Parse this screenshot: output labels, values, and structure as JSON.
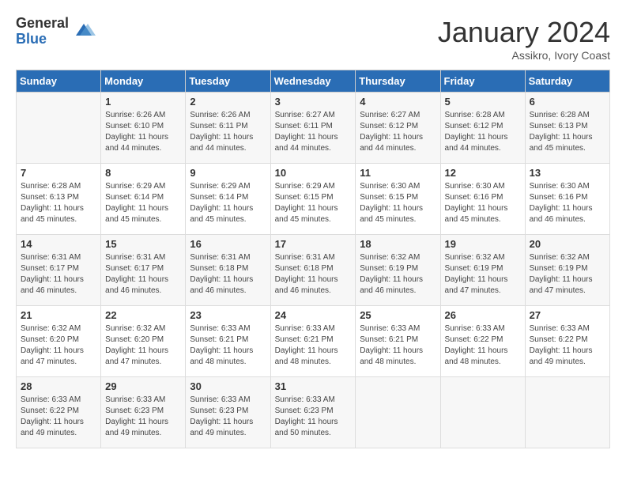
{
  "header": {
    "logo_general": "General",
    "logo_blue": "Blue",
    "month_title": "January 2024",
    "subtitle": "Assikro, Ivory Coast"
  },
  "calendar": {
    "days_of_week": [
      "Sunday",
      "Monday",
      "Tuesday",
      "Wednesday",
      "Thursday",
      "Friday",
      "Saturday"
    ],
    "weeks": [
      [
        {
          "day": "",
          "sunrise": "",
          "sunset": "",
          "daylight": ""
        },
        {
          "day": "1",
          "sunrise": "Sunrise: 6:26 AM",
          "sunset": "Sunset: 6:10 PM",
          "daylight": "Daylight: 11 hours and 44 minutes."
        },
        {
          "day": "2",
          "sunrise": "Sunrise: 6:26 AM",
          "sunset": "Sunset: 6:11 PM",
          "daylight": "Daylight: 11 hours and 44 minutes."
        },
        {
          "day": "3",
          "sunrise": "Sunrise: 6:27 AM",
          "sunset": "Sunset: 6:11 PM",
          "daylight": "Daylight: 11 hours and 44 minutes."
        },
        {
          "day": "4",
          "sunrise": "Sunrise: 6:27 AM",
          "sunset": "Sunset: 6:12 PM",
          "daylight": "Daylight: 11 hours and 44 minutes."
        },
        {
          "day": "5",
          "sunrise": "Sunrise: 6:28 AM",
          "sunset": "Sunset: 6:12 PM",
          "daylight": "Daylight: 11 hours and 44 minutes."
        },
        {
          "day": "6",
          "sunrise": "Sunrise: 6:28 AM",
          "sunset": "Sunset: 6:13 PM",
          "daylight": "Daylight: 11 hours and 45 minutes."
        }
      ],
      [
        {
          "day": "7",
          "sunrise": "Sunrise: 6:28 AM",
          "sunset": "Sunset: 6:13 PM",
          "daylight": "Daylight: 11 hours and 45 minutes."
        },
        {
          "day": "8",
          "sunrise": "Sunrise: 6:29 AM",
          "sunset": "Sunset: 6:14 PM",
          "daylight": "Daylight: 11 hours and 45 minutes."
        },
        {
          "day": "9",
          "sunrise": "Sunrise: 6:29 AM",
          "sunset": "Sunset: 6:14 PM",
          "daylight": "Daylight: 11 hours and 45 minutes."
        },
        {
          "day": "10",
          "sunrise": "Sunrise: 6:29 AM",
          "sunset": "Sunset: 6:15 PM",
          "daylight": "Daylight: 11 hours and 45 minutes."
        },
        {
          "day": "11",
          "sunrise": "Sunrise: 6:30 AM",
          "sunset": "Sunset: 6:15 PM",
          "daylight": "Daylight: 11 hours and 45 minutes."
        },
        {
          "day": "12",
          "sunrise": "Sunrise: 6:30 AM",
          "sunset": "Sunset: 6:16 PM",
          "daylight": "Daylight: 11 hours and 45 minutes."
        },
        {
          "day": "13",
          "sunrise": "Sunrise: 6:30 AM",
          "sunset": "Sunset: 6:16 PM",
          "daylight": "Daylight: 11 hours and 46 minutes."
        }
      ],
      [
        {
          "day": "14",
          "sunrise": "Sunrise: 6:31 AM",
          "sunset": "Sunset: 6:17 PM",
          "daylight": "Daylight: 11 hours and 46 minutes."
        },
        {
          "day": "15",
          "sunrise": "Sunrise: 6:31 AM",
          "sunset": "Sunset: 6:17 PM",
          "daylight": "Daylight: 11 hours and 46 minutes."
        },
        {
          "day": "16",
          "sunrise": "Sunrise: 6:31 AM",
          "sunset": "Sunset: 6:18 PM",
          "daylight": "Daylight: 11 hours and 46 minutes."
        },
        {
          "day": "17",
          "sunrise": "Sunrise: 6:31 AM",
          "sunset": "Sunset: 6:18 PM",
          "daylight": "Daylight: 11 hours and 46 minutes."
        },
        {
          "day": "18",
          "sunrise": "Sunrise: 6:32 AM",
          "sunset": "Sunset: 6:19 PM",
          "daylight": "Daylight: 11 hours and 46 minutes."
        },
        {
          "day": "19",
          "sunrise": "Sunrise: 6:32 AM",
          "sunset": "Sunset: 6:19 PM",
          "daylight": "Daylight: 11 hours and 47 minutes."
        },
        {
          "day": "20",
          "sunrise": "Sunrise: 6:32 AM",
          "sunset": "Sunset: 6:19 PM",
          "daylight": "Daylight: 11 hours and 47 minutes."
        }
      ],
      [
        {
          "day": "21",
          "sunrise": "Sunrise: 6:32 AM",
          "sunset": "Sunset: 6:20 PM",
          "daylight": "Daylight: 11 hours and 47 minutes."
        },
        {
          "day": "22",
          "sunrise": "Sunrise: 6:32 AM",
          "sunset": "Sunset: 6:20 PM",
          "daylight": "Daylight: 11 hours and 47 minutes."
        },
        {
          "day": "23",
          "sunrise": "Sunrise: 6:33 AM",
          "sunset": "Sunset: 6:21 PM",
          "daylight": "Daylight: 11 hours and 48 minutes."
        },
        {
          "day": "24",
          "sunrise": "Sunrise: 6:33 AM",
          "sunset": "Sunset: 6:21 PM",
          "daylight": "Daylight: 11 hours and 48 minutes."
        },
        {
          "day": "25",
          "sunrise": "Sunrise: 6:33 AM",
          "sunset": "Sunset: 6:21 PM",
          "daylight": "Daylight: 11 hours and 48 minutes."
        },
        {
          "day": "26",
          "sunrise": "Sunrise: 6:33 AM",
          "sunset": "Sunset: 6:22 PM",
          "daylight": "Daylight: 11 hours and 48 minutes."
        },
        {
          "day": "27",
          "sunrise": "Sunrise: 6:33 AM",
          "sunset": "Sunset: 6:22 PM",
          "daylight": "Daylight: 11 hours and 49 minutes."
        }
      ],
      [
        {
          "day": "28",
          "sunrise": "Sunrise: 6:33 AM",
          "sunset": "Sunset: 6:22 PM",
          "daylight": "Daylight: 11 hours and 49 minutes."
        },
        {
          "day": "29",
          "sunrise": "Sunrise: 6:33 AM",
          "sunset": "Sunset: 6:23 PM",
          "daylight": "Daylight: 11 hours and 49 minutes."
        },
        {
          "day": "30",
          "sunrise": "Sunrise: 6:33 AM",
          "sunset": "Sunset: 6:23 PM",
          "daylight": "Daylight: 11 hours and 49 minutes."
        },
        {
          "day": "31",
          "sunrise": "Sunrise: 6:33 AM",
          "sunset": "Sunset: 6:23 PM",
          "daylight": "Daylight: 11 hours and 50 minutes."
        },
        {
          "day": "",
          "sunrise": "",
          "sunset": "",
          "daylight": ""
        },
        {
          "day": "",
          "sunrise": "",
          "sunset": "",
          "daylight": ""
        },
        {
          "day": "",
          "sunrise": "",
          "sunset": "",
          "daylight": ""
        }
      ]
    ]
  }
}
